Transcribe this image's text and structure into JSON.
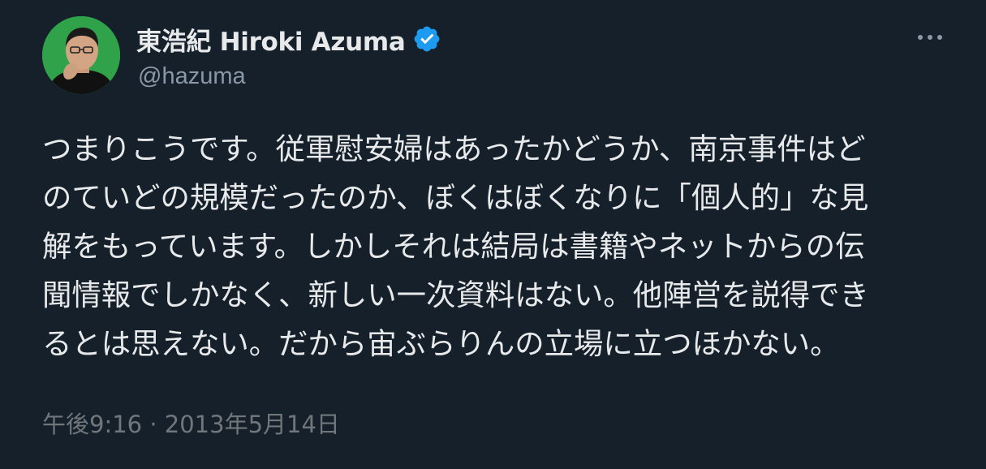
{
  "author": {
    "display_name": "東浩紀 Hiroki Azuma",
    "handle": "@hazuma",
    "verified": true,
    "avatar_icon": "profile-photo"
  },
  "menu": {
    "icon": "more-horizontal-icon"
  },
  "tweet": {
    "text_lines": [
      "つまりこうです。従軍慰安婦はあったかどうか、南京事件はど",
      "のていどの規模だったのか、ぼくはぼくなりに「個人的」な見",
      "解をもっています。しかしそれは結局は書籍やネットからの伝",
      "聞情報でしかなく、新しい一次資料はない。他陣営を説得でき",
      "るとは思えない。だから宙ぶらりんの立場に立つほかない。"
    ],
    "timestamp": "午後9:16 · 2013年5月14日"
  },
  "colors": {
    "background": "#15202b",
    "text": "#e7e9ea",
    "secondary_text": "#8b98a5",
    "verified_badge": "#1d9bf0",
    "avatar_background": "#2fa24a"
  }
}
